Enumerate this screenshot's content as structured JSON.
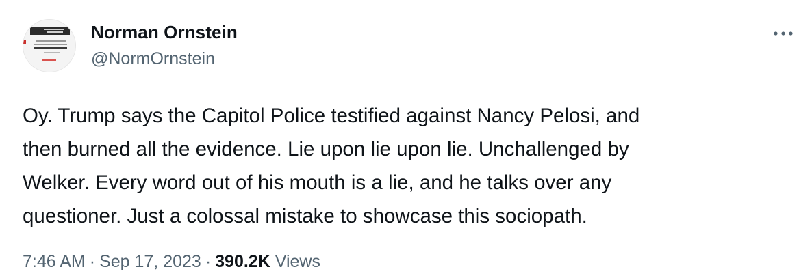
{
  "author": {
    "name": "Norman Ornstein",
    "handle": "@NormOrnstein"
  },
  "tweet": {
    "text": "Oy. Trump says the Capitol Police testified against Nancy Pelosi, and\nthen burned all the evidence. Lie upon lie upon lie. Unchallenged by\nWelker. Every word out of his mouth is a lie, and he talks over any\nquestioner. Just a colossal mistake to showcase this sociopath."
  },
  "meta": {
    "time": "7:46 AM",
    "separator": "·",
    "date": "Sep 17, 2023",
    "views_count": "390.2K",
    "views_label": "Views"
  },
  "icons": {
    "more": "more-horizontal-icon",
    "avatar": "book-cover-avatar"
  },
  "colors": {
    "text_primary": "#0f1419",
    "text_secondary": "#536471",
    "background": "#ffffff"
  }
}
